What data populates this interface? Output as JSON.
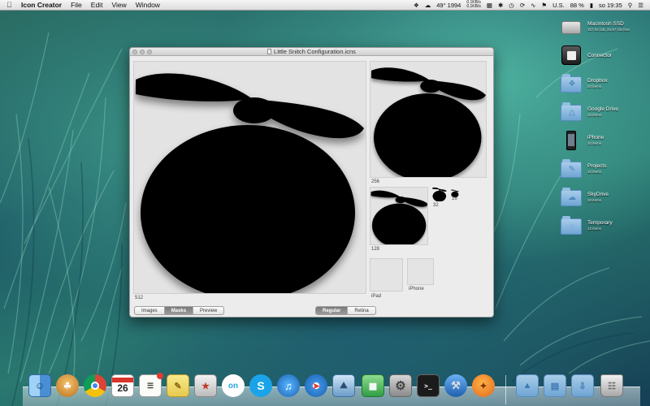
{
  "menubar": {
    "apple": "",
    "app_name": "Icon Creator",
    "menus": [
      "File",
      "Edit",
      "View",
      "Window"
    ],
    "status": {
      "weather": "49° 1994",
      "net_up": "0.1KB/s",
      "net_down": "0.1KB/s",
      "locale": "U.S.",
      "battery": "88 %",
      "clock": "so 19:35"
    }
  },
  "window": {
    "title": "Little Snitch Configuration.icns",
    "sizes": {
      "s512": "512",
      "s256": "256",
      "s128": "128",
      "s32": "32",
      "s16": "16",
      "ipad": "iPad",
      "iphone": "iPhone"
    },
    "view_tabs": [
      "Images",
      "Masks",
      "Preview"
    ],
    "active_view_tab": "Masks",
    "resolution_tabs": [
      "Regular",
      "Retina"
    ],
    "active_resolution_tab": "Regular"
  },
  "desktop": {
    "items": [
      {
        "name": "Macintosh SSD",
        "sub": "107.04 GB, 25.97 GB free"
      },
      {
        "name": "Connector",
        "sub": ""
      },
      {
        "name": "Dropbox",
        "sub": "20 items"
      },
      {
        "name": "Google Drive",
        "sub": "10 items"
      },
      {
        "name": "iPhone",
        "sub": "10 items"
      },
      {
        "name": "Projects",
        "sub": "10 items"
      },
      {
        "name": "SkyDrive",
        "sub": "10 items"
      },
      {
        "name": "Temporary",
        "sub": "12 items"
      }
    ]
  },
  "dock": {
    "calendar_day": "26",
    "ichat_label": "on"
  },
  "colors": {
    "accent": "#6fa5d4",
    "menubar": "#e9e9e9",
    "window_bg": "#ececec"
  }
}
